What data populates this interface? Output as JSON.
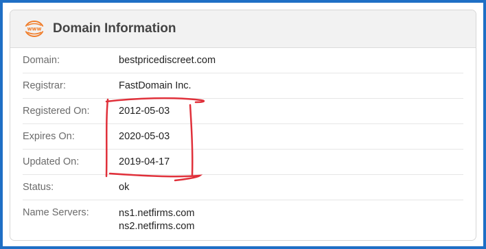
{
  "header": {
    "icon": "www-globe-icon",
    "icon_text": "www",
    "title": "Domain Information",
    "accent_color": "#f07d2a"
  },
  "rows": [
    {
      "label": "Domain:",
      "value": "bestpricediscreet.com"
    },
    {
      "label": "Registrar:",
      "value": "FastDomain Inc."
    },
    {
      "label": "Registered On:",
      "value": "2012-05-03"
    },
    {
      "label": "Expires On:",
      "value": "2020-05-03"
    },
    {
      "label": "Updated On:",
      "value": "2019-04-17"
    },
    {
      "label": "Status:",
      "value": "ok"
    },
    {
      "label": "Name Servers:",
      "values": [
        "ns1.netfirms.com",
        "ns2.netfirms.com"
      ]
    }
  ],
  "annotation": {
    "color": "#e0303a"
  },
  "colors": {
    "border": "#1f6fc5"
  }
}
